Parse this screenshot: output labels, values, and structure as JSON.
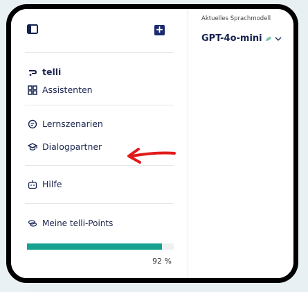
{
  "header": {
    "model_caption": "Aktuelles Sprachmodell",
    "model_name": "GPT-4o-mini"
  },
  "sidebar": {
    "new_chat_symbol": "+",
    "items": [
      {
        "label": "telli",
        "icon": "telli-logo-icon"
      },
      {
        "label": "Assistenten",
        "icon": "grid-icon"
      },
      {
        "label": "Lernszenarien",
        "icon": "chat-icon"
      },
      {
        "label": "Dialogpartner",
        "icon": "graduation-cap-icon"
      },
      {
        "label": "Hilfe",
        "icon": "robot-icon"
      },
      {
        "label": "Meine telli-Points",
        "icon": "coins-icon"
      }
    ],
    "points": {
      "percent_text": "92 %",
      "fraction": 0.92
    }
  },
  "colors": {
    "accent": "#1a2b72",
    "progress": "#17a191",
    "annotation_arrow": "#e11b1b",
    "leaf": "#7cc3b2"
  }
}
